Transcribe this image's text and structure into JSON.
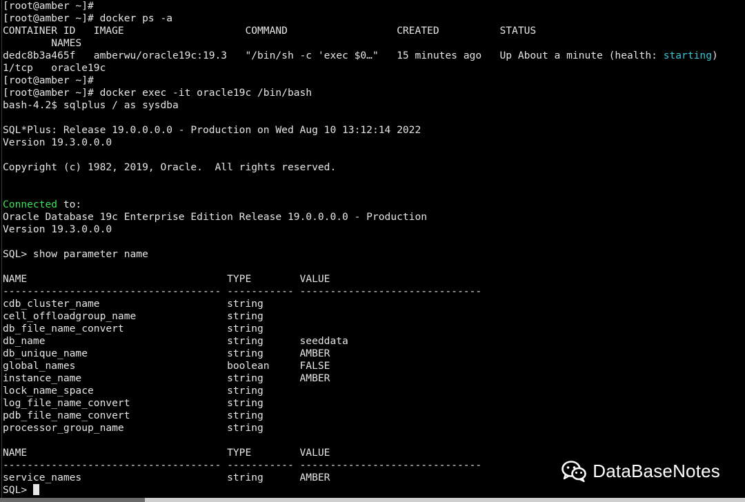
{
  "terminal": {
    "lines": [
      {
        "text": "[root@amber ~]#"
      },
      {
        "text": "[root@amber ~]# docker ps -a"
      },
      {
        "text": "CONTAINER ID   IMAGE                    COMMAND                  CREATED          STATUS"
      },
      {
        "text": "        NAMES"
      },
      {
        "text": "dedc8b3a465f   amberwu/oracle19c:19.3   \"/bin/sh -c 'exec $0…\"   15 minutes ago   Up About a minute (health: ",
        "status_highlight": "starting",
        "status_tail": ")"
      },
      {
        "text": "1/tcp   oracle19c"
      },
      {
        "text": "[root@amber ~]#"
      },
      {
        "text": "[root@amber ~]# docker exec -it oracle19c /bin/bash"
      },
      {
        "text": "bash-4.2$ sqlplus / as sysdba"
      },
      {
        "text": ""
      },
      {
        "text": "SQL*Plus: Release 19.0.0.0.0 - Production on Wed Aug 10 13:12:14 2022"
      },
      {
        "text": "Version 19.3.0.0.0"
      },
      {
        "text": ""
      },
      {
        "text": "Copyright (c) 1982, 2019, Oracle.  All rights reserved."
      },
      {
        "text": ""
      },
      {
        "text": ""
      },
      {
        "connected_word": "Connected",
        "connected_tail": " to:"
      },
      {
        "text": "Oracle Database 19c Enterprise Edition Release 19.0.0.0.0 - Production"
      },
      {
        "text": "Version 19.3.0.0.0"
      },
      {
        "text": ""
      },
      {
        "text": "SQL> show parameter name"
      },
      {
        "text": ""
      },
      {
        "text": "NAME                                 TYPE        VALUE"
      },
      {
        "text": "------------------------------------ ----------- ------------------------------"
      },
      {
        "text": "cdb_cluster_name                     string"
      },
      {
        "text": "cell_offloadgroup_name               string"
      },
      {
        "text": "db_file_name_convert                 string"
      },
      {
        "text": "db_name                              string      seeddata"
      },
      {
        "text": "db_unique_name                       string      AMBER"
      },
      {
        "text": "global_names                         boolean     FALSE"
      },
      {
        "text": "instance_name                        string      AMBER"
      },
      {
        "text": "lock_name_space                      string"
      },
      {
        "text": "log_file_name_convert                string"
      },
      {
        "text": "pdb_file_name_convert                string"
      },
      {
        "text": "processor_group_name                 string"
      },
      {
        "text": ""
      },
      {
        "text": "NAME                                 TYPE        VALUE"
      },
      {
        "text": "------------------------------------ ----------- ------------------------------"
      },
      {
        "text": "service_names                        string      AMBER"
      },
      {
        "prompt": "SQL> "
      }
    ]
  },
  "watermark": {
    "text": "DataBaseNotes",
    "icon": "wechat-icon"
  },
  "colors": {
    "background": "#000000",
    "foreground": "#e6e6e6",
    "highlight_green": "#3ee25a",
    "highlight_cyan": "#35c7d6"
  }
}
